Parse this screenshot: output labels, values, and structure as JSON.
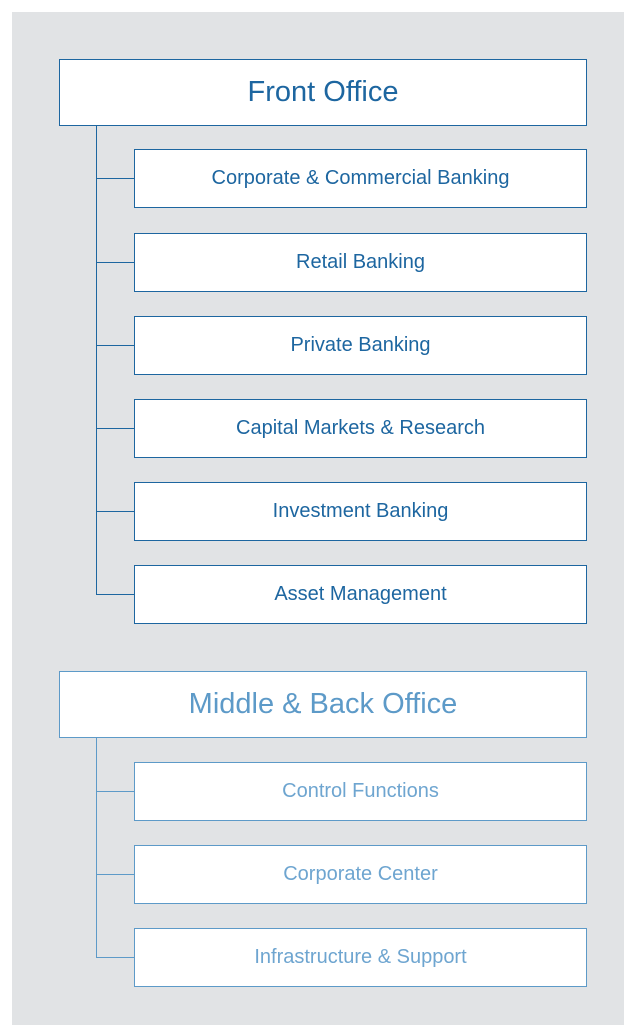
{
  "groups": [
    {
      "title": "Front Office",
      "items": [
        "Corporate & Commercial Banking",
        "Retail Banking",
        "Private Banking",
        "Capital Markets & Research",
        "Investment Banking",
        "Asset Management"
      ]
    },
    {
      "title": "Middle & Back Office",
      "items": [
        "Control Functions",
        "Corporate Center",
        "Infrastructure & Support"
      ]
    }
  ],
  "colors": {
    "background": "#e1e3e5",
    "primary": "#1d66a0",
    "muted": "#5d9ac8"
  }
}
